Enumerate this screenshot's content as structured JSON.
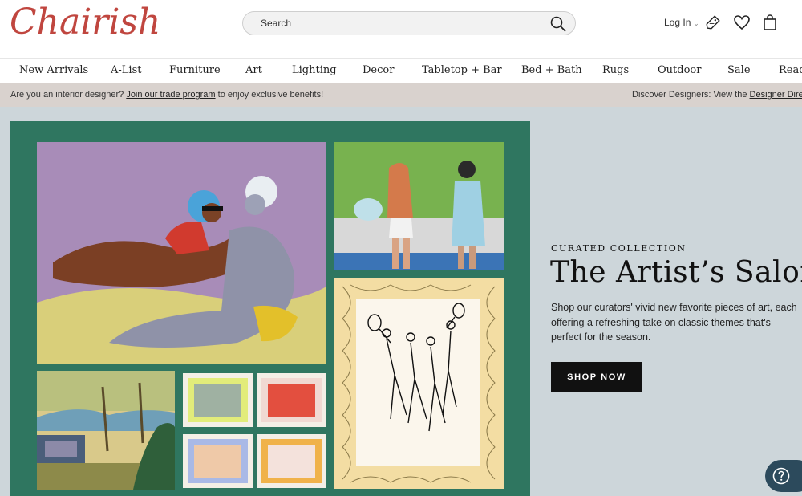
{
  "brand": {
    "logo_text": "Chairish",
    "accent": "#c0463f"
  },
  "search": {
    "placeholder": "Search",
    "icon": "search-icon"
  },
  "header": {
    "login_label": "Log In",
    "icons": [
      "sale-tag-icon",
      "heart-icon",
      "shopping-bag-icon"
    ]
  },
  "nav": {
    "items": [
      "New Arrivals",
      "A-List",
      "Furniture",
      "Art",
      "Lighting",
      "Decor",
      "Tabletop + Bar",
      "Bed + Bath",
      "Rugs",
      "Outdoor",
      "Sale",
      "Read"
    ]
  },
  "promo": {
    "left_prefix": "Are you an interior designer?",
    "left_link": "Join our trade program",
    "left_suffix": "to enjoy exclusive benefits!",
    "right_prefix": "Discover Designers: View the",
    "right_link": "Designer Directory"
  },
  "hero": {
    "eyebrow": "CURATED COLLECTION",
    "title": "The Artist’s Salon",
    "description": "Shop our curators' vivid new favorite pieces of art, each offering a refreshing take on classic themes that's perfect for the season.",
    "cta_label": "SHOP NOW",
    "background": "#cdd6da",
    "art_frame_color": "#2f7660"
  },
  "help": {
    "icon": "help-icon"
  }
}
